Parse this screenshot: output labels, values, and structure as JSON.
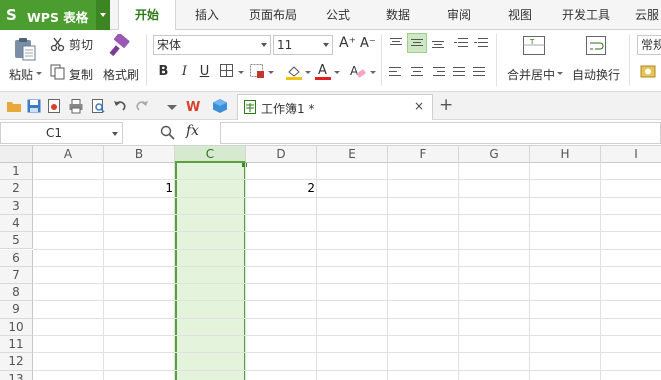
{
  "app": {
    "logo": "S",
    "title": "WPS 表格"
  },
  "menu": {
    "tabs": [
      {
        "label": "开始",
        "active": true
      },
      {
        "label": "插入"
      },
      {
        "label": "页面布局"
      },
      {
        "label": "公式"
      },
      {
        "label": "数据"
      },
      {
        "label": "审阅"
      },
      {
        "label": "视图"
      },
      {
        "label": "开发工具"
      },
      {
        "label": "云服"
      }
    ]
  },
  "ribbon": {
    "paste": "粘贴",
    "cut": "剪切",
    "copy": "复制",
    "format_painter": "格式刷",
    "font_name": "宋体",
    "font_size": "11",
    "bold": "B",
    "italic": "I",
    "underline": "U",
    "merge_center": "合并居中",
    "wrap_text": "自动换行",
    "number_format": "常规",
    "grow_font": "A⁺",
    "shrink_font": "A⁻"
  },
  "doc_tabs": {
    "file_name": "工作簿1 *",
    "close": "×",
    "new": "+"
  },
  "formula_bar": {
    "cell_ref": "C1",
    "fx": "fx",
    "value": ""
  },
  "sheet": {
    "columns": [
      "A",
      "B",
      "C",
      "D",
      "E",
      "F",
      "G",
      "H",
      "I"
    ],
    "selected_column": "C",
    "rows": [
      "1",
      "2",
      "3",
      "4",
      "5",
      "6",
      "7",
      "8",
      "9",
      "10",
      "11",
      "12",
      "13"
    ],
    "cells": {
      "B2": "1",
      "D2": "2"
    }
  },
  "colors": {
    "accent": "#4a9d2e",
    "selection_fill": "#e3f3dc",
    "selection_border": "#5aa03c"
  }
}
